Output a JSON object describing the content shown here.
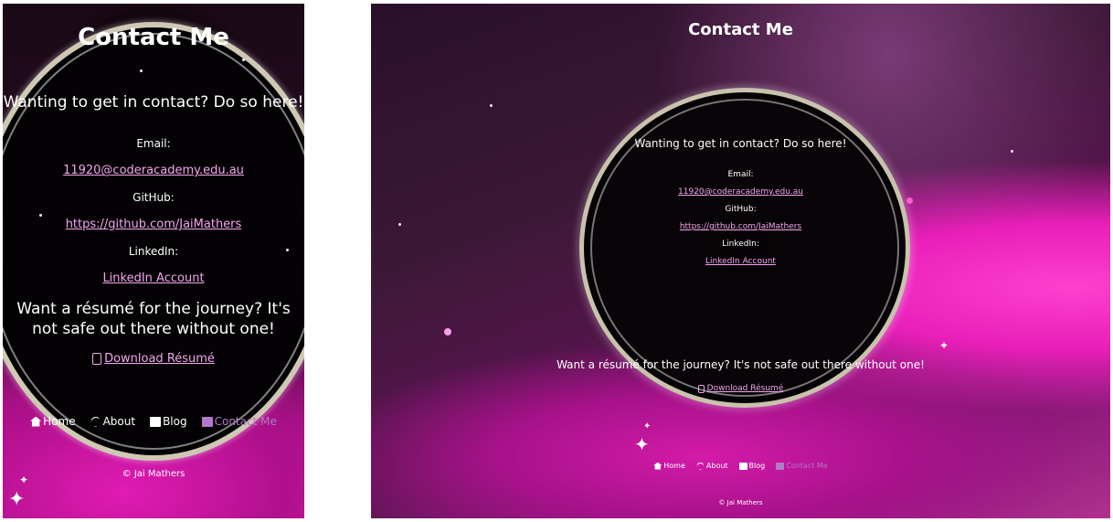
{
  "mobile": {
    "title": "Contact Me",
    "lead": "Wanting to get in contact? Do so here!",
    "email_label": "Email:",
    "email_link": "11920@coderacademy.edu.au",
    "github_label": "GitHub:",
    "github_link": "https://github.com/JaiMathers",
    "linkedin_label": "LinkedIn:",
    "linkedin_link": "LinkedIn Account",
    "resume_text": "Want a résumé for the journey? It's not safe out there without one!",
    "resume_link": "Download Résumé",
    "nav": {
      "home": "Home",
      "about": "About",
      "blog": "Blog",
      "contact": "Contact Me"
    },
    "footer": "© Jai Mathers"
  },
  "desktop": {
    "title": "Contact Me",
    "lead": "Wanting to get in contact? Do so here!",
    "email_label": "Email:",
    "email_link": "11920@coderacademy.edu.au",
    "github_label": "GitHub:",
    "github_link": "https://github.com/JaiMathers",
    "linkedin_label": "LinkedIn:",
    "linkedin_link": "LinkedIn Account",
    "resume_text": "Want a résumé for the journey? It's not safe out there without one!",
    "resume_link": "Download Résumé",
    "nav": {
      "home": "Home",
      "about": "About",
      "blog": "Blog",
      "contact": "Contact Me"
    },
    "footer": "© Jai Mathers"
  },
  "colors": {
    "link": "#f3a6ec",
    "active_nav": "#b07ac6",
    "accent": "#e21db9"
  },
  "icons": [
    "home-icon",
    "user-icon",
    "blog-icon",
    "contact-icon",
    "document-icon"
  ]
}
